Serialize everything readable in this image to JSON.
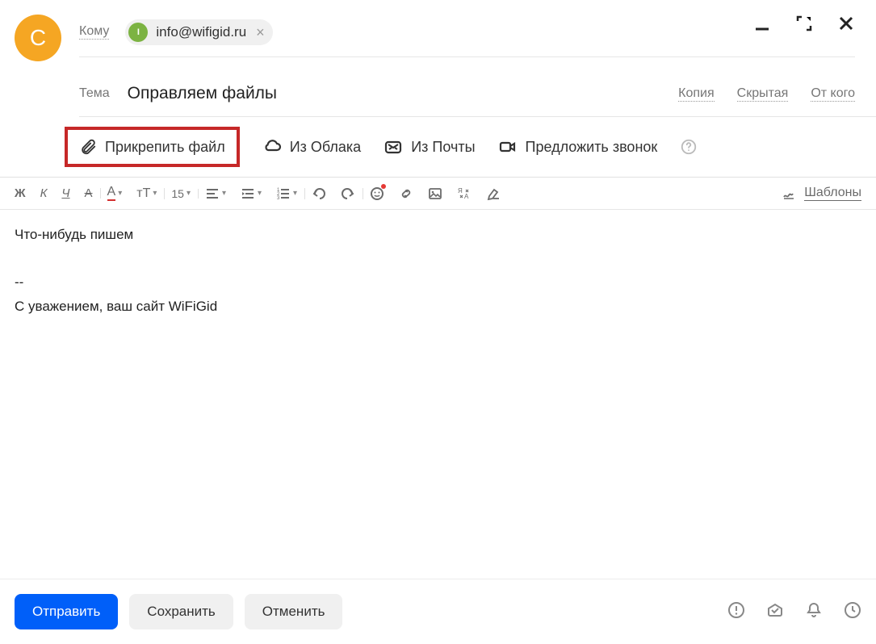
{
  "avatar_letter": "С",
  "to_label": "Кому",
  "recipient": {
    "initial": "I",
    "email": "info@wifigid.ru"
  },
  "subject_label": "Тема",
  "subject_value": "Оправляем файлы",
  "links": {
    "copy": "Копия",
    "hidden": "Скрытая",
    "from": "От кого"
  },
  "attach": {
    "file": "Прикрепить файл",
    "cloud": "Из Облака",
    "mail": "Из Почты",
    "call": "Предложить звонок"
  },
  "toolbar": {
    "bold": "Ж",
    "italic": "К",
    "underline": "Ч",
    "strike": "А",
    "color": "А",
    "fontsize": "тТ",
    "size_value": "15",
    "templates": "Шаблоны"
  },
  "body": {
    "line1": "Что-нибудь пишем",
    "divider": "--",
    "signature": "С уважением, ваш сайт WiFiGid"
  },
  "footer": {
    "send": "Отправить",
    "save": "Сохранить",
    "cancel": "Отменить"
  }
}
